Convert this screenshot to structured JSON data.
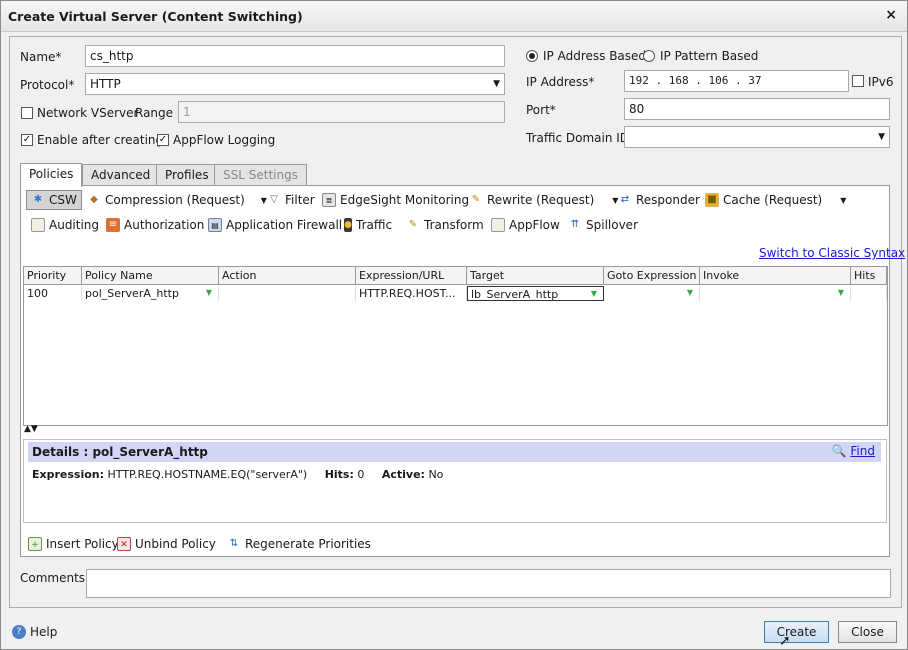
{
  "window": {
    "title": "Create Virtual Server (Content Switching)"
  },
  "form": {
    "name_label": "Name*",
    "name_value": "cs_http",
    "protocol_label": "Protocol*",
    "protocol_value": "HTTP",
    "network_vserver_label": "Network VServer",
    "network_vserver_checked": false,
    "range_label": "Range",
    "range_value": "1",
    "enable_label": "Enable after creating",
    "enable_checked": true,
    "appflow_label": "AppFlow Logging",
    "appflow_checked": true,
    "ip_based_label": "IP Address Based",
    "ip_pattern_label": "IP Pattern Based",
    "ip_address_label": "IP Address*",
    "ip_address_value": "192 . 168 . 106 . 37",
    "ipv6_label": "IPv6",
    "port_label": "Port*",
    "port_value": "80",
    "traffic_domain_label": "Traffic Domain ID",
    "traffic_domain_value": ""
  },
  "tabs": [
    "Policies",
    "Advanced",
    "Profiles",
    "SSL Settings"
  ],
  "toolbar": {
    "row1": [
      {
        "label": "CSW",
        "icon": "csw-icon",
        "caret": false
      },
      {
        "label": "Compression (Request)",
        "icon": "compression-icon",
        "caret": true
      },
      {
        "label": "Filter",
        "icon": "filter-icon",
        "caret": false
      },
      {
        "label": "EdgeSight Monitoring",
        "icon": "edgesight-icon",
        "caret": false
      },
      {
        "label": "Rewrite (Request)",
        "icon": "rewrite-icon",
        "caret": true
      },
      {
        "label": "Responder",
        "icon": "responder-icon",
        "caret": false
      },
      {
        "label": "Cache (Request)",
        "icon": "cache-icon",
        "caret": true
      }
    ],
    "row2": [
      {
        "label": "Auditing",
        "icon": "auditing-icon"
      },
      {
        "label": "Authorization",
        "icon": "authorization-icon"
      },
      {
        "label": "Application Firewall",
        "icon": "firewall-icon"
      },
      {
        "label": "Traffic",
        "icon": "traffic-icon"
      },
      {
        "label": "Transform",
        "icon": "transform-icon"
      },
      {
        "label": "AppFlow",
        "icon": "appflow-icon"
      },
      {
        "label": "Spillover",
        "icon": "spillover-icon"
      }
    ]
  },
  "classic_syntax_link": "Switch to Classic Syntax",
  "grid": {
    "columns": [
      "Priority",
      "Policy Name",
      "Action",
      "Expression/URL",
      "Target",
      "Goto Expression",
      "Invoke",
      "Hits"
    ],
    "rows": [
      {
        "priority": "100",
        "policy_name": "pol_ServerA_http",
        "action": "",
        "expression": "HTTP.REQ.HOST...",
        "target": "lb_ServerA_http",
        "goto": "",
        "invoke": "",
        "hits": ""
      }
    ]
  },
  "details": {
    "title": "Details : pol_ServerA_http",
    "find_label": "Find",
    "expression_label": "Expression:",
    "expression_value": "HTTP.REQ.HOSTNAME.EQ(\"serverA\")",
    "hits_label": "Hits:",
    "hits_value": "0",
    "active_label": "Active:",
    "active_value": "No"
  },
  "actions": {
    "insert_policy": "Insert Policy",
    "unbind_policy": "Unbind Policy",
    "regenerate_priorities": "Regenerate Priorities"
  },
  "comments_label": "Comments",
  "comments_value": "",
  "footer": {
    "help_label": "Help",
    "create_label": "Create",
    "close_label": "Close"
  }
}
